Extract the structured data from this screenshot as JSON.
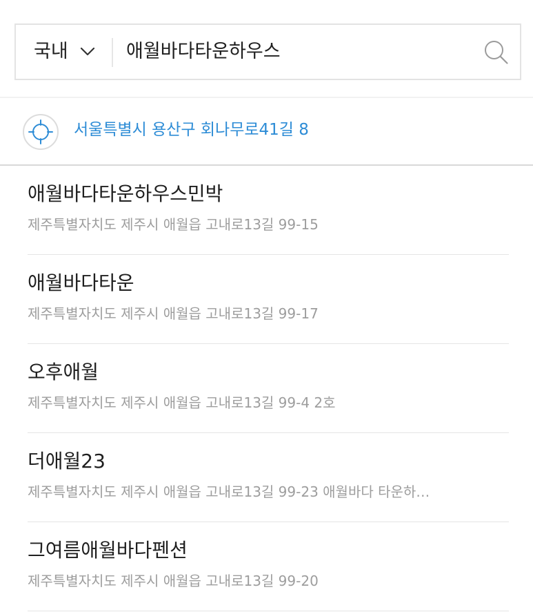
{
  "search": {
    "region": "국내",
    "query": "애월바다타운하우스"
  },
  "current_location": {
    "address": "서울특별시 용산구 회나무로41길 8"
  },
  "results": [
    {
      "title": "애월바다타운하우스민박",
      "address": "제주특별자치도 제주시 애월읍 고내로13길 99-15"
    },
    {
      "title": "애월바다타운",
      "address": "제주특별자치도 제주시 애월읍 고내로13길 99-17"
    },
    {
      "title": "오후애월",
      "address": "제주특별자치도 제주시 애월읍 고내로13길 99-4 2호"
    },
    {
      "title": "더애월23",
      "address": "제주특별자치도 제주시 애월읍 고내로13길 99-23 애월바다 타운하…"
    },
    {
      "title": "그여름애월바다펜션",
      "address": "제주특별자치도 제주시 애월읍 고내로13길 99-20"
    }
  ],
  "colors": {
    "accent": "#2d8cd6",
    "text": "#1f1f1f",
    "muted": "#9d9d9d"
  },
  "icons": {
    "search": "search-icon",
    "region_dropdown": "chevron-down-icon",
    "current_location": "crosshair-icon"
  }
}
